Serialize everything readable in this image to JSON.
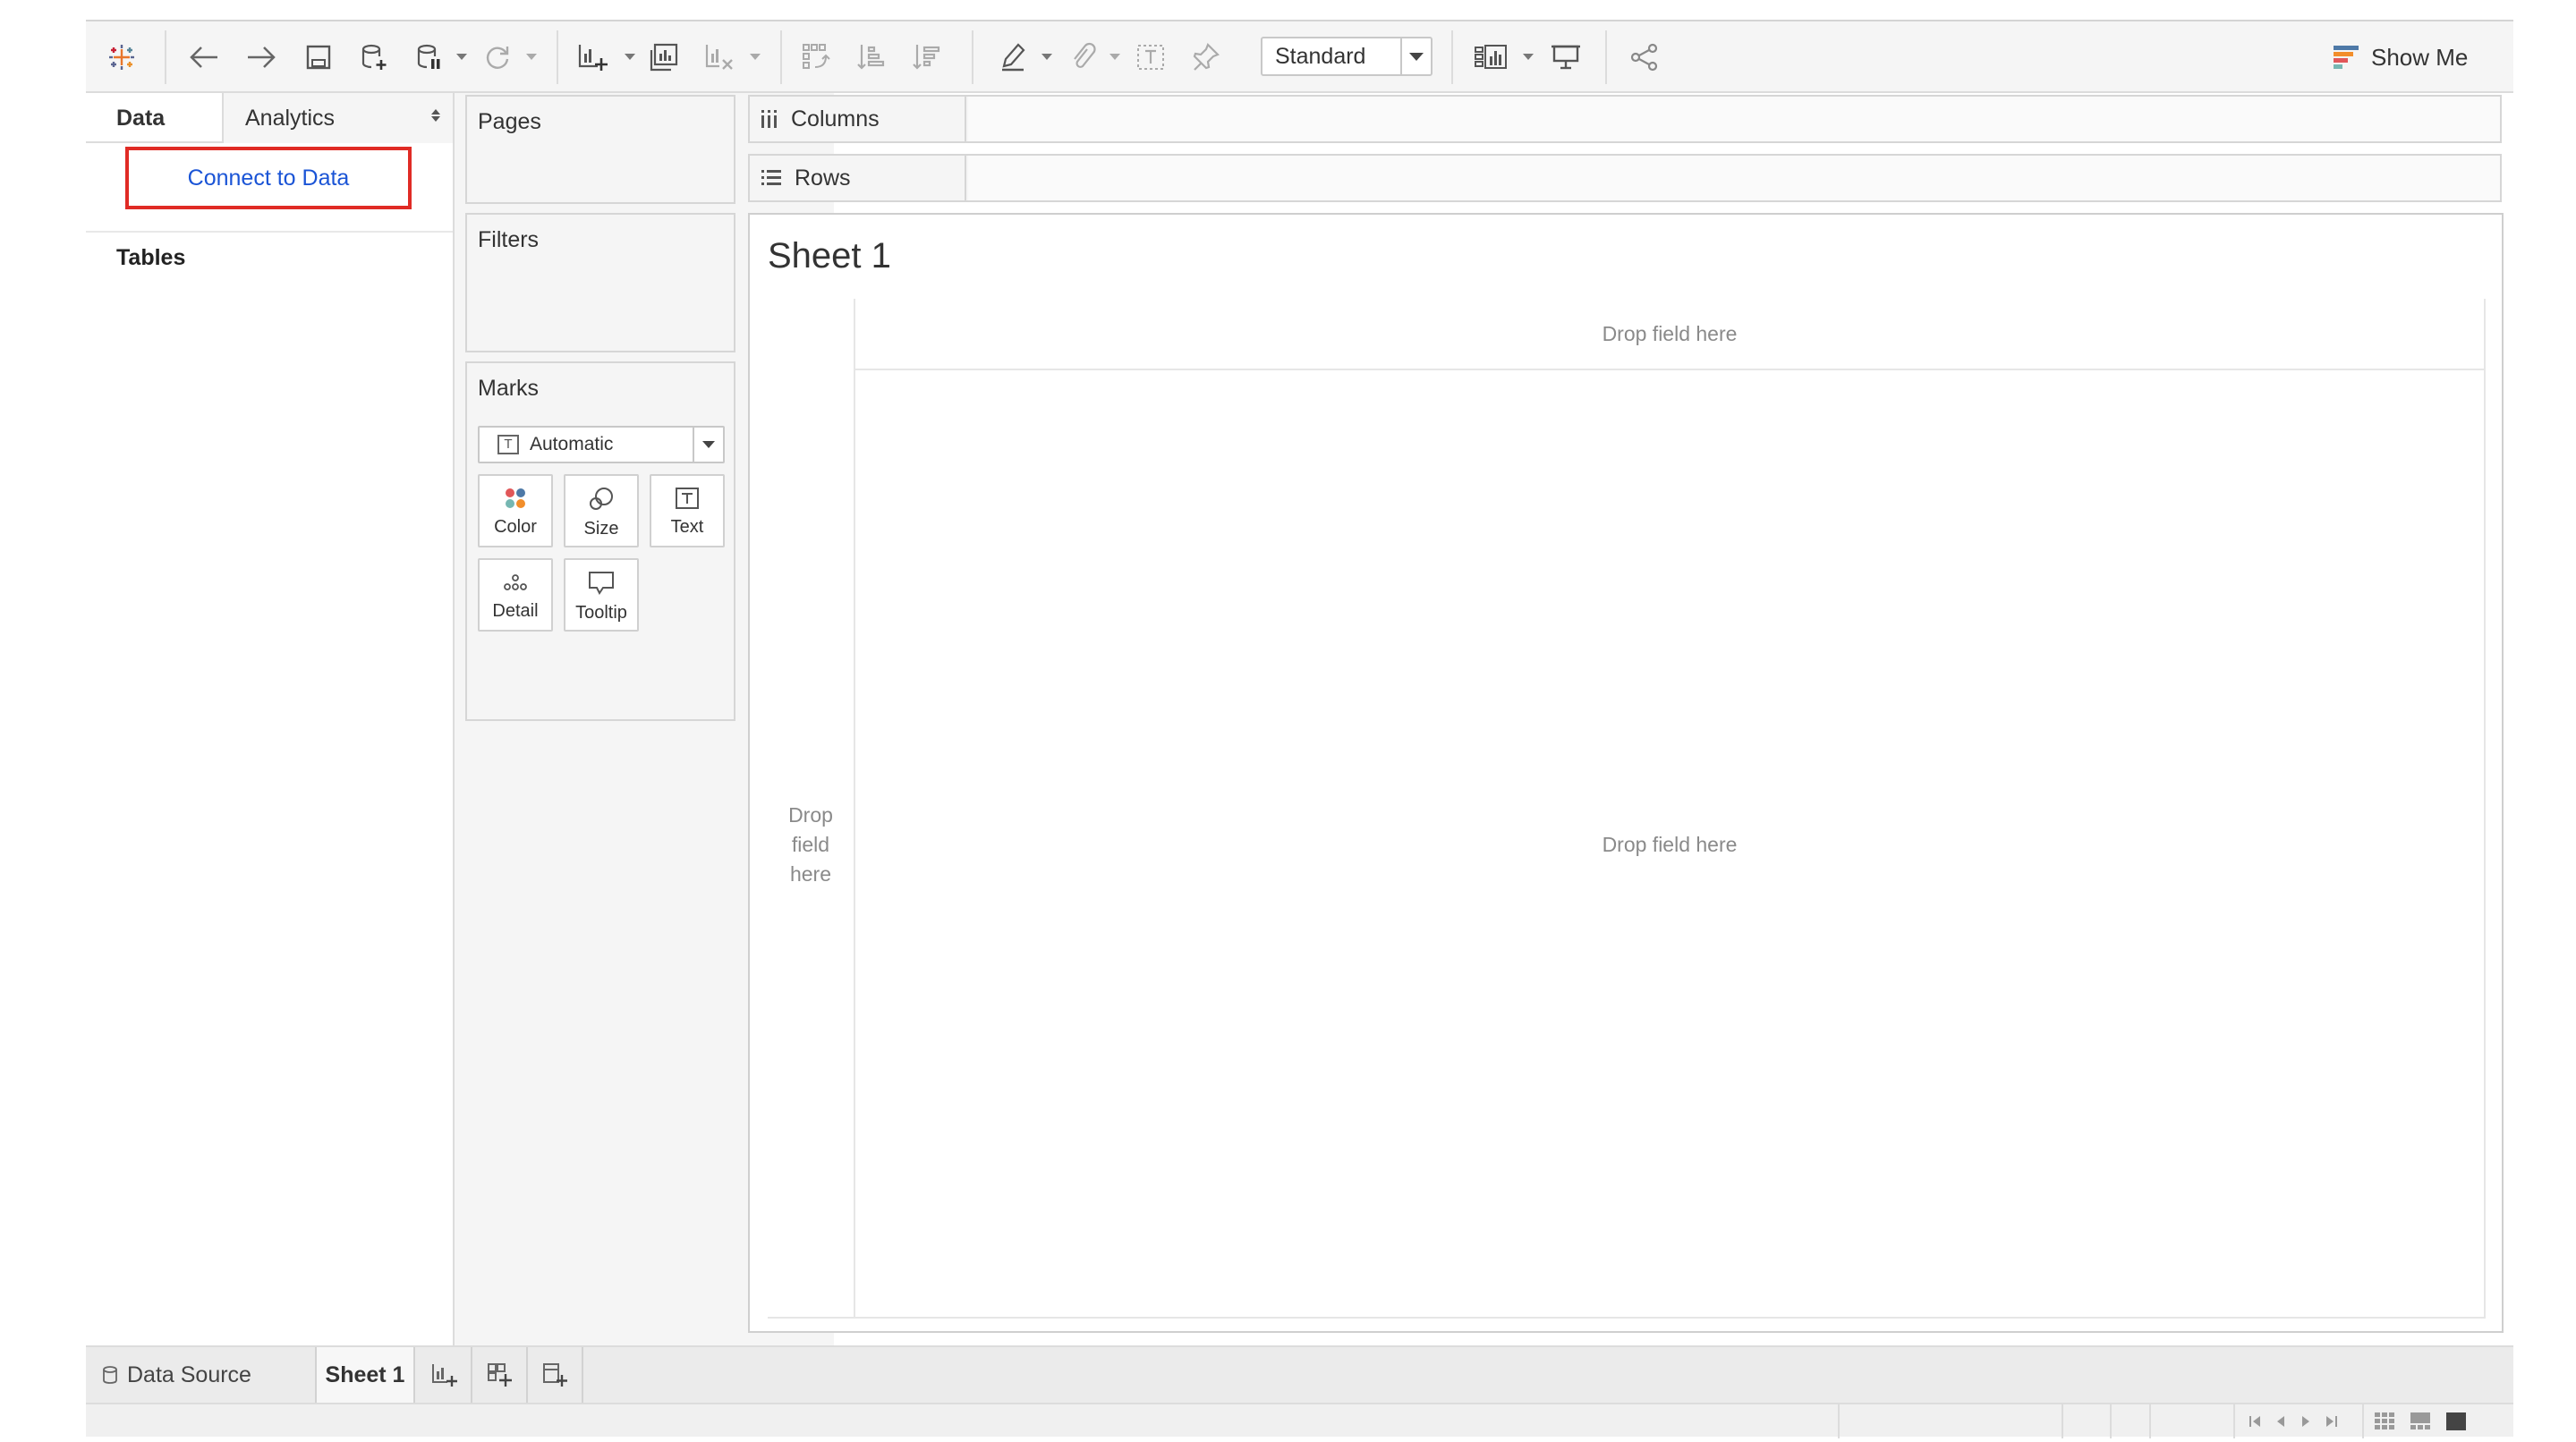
{
  "toolbar": {
    "fit_value": "Standard",
    "show_me_label": "Show Me",
    "show_me_colors": [
      "#4e79a7",
      "#f28e2b",
      "#e15759",
      "#76b7b2"
    ]
  },
  "data_pane": {
    "tabs": {
      "data": "Data",
      "analytics": "Analytics"
    },
    "connect_label": "Connect to Data",
    "tables_heading": "Tables"
  },
  "cards": {
    "pages": "Pages",
    "filters": "Filters",
    "marks": {
      "title": "Marks",
      "mark_type": "Automatic",
      "buttons": {
        "color": "Color",
        "size": "Size",
        "text": "Text",
        "detail": "Detail",
        "tooltip": "Tooltip"
      },
      "color_dots": [
        "#e15759",
        "#4e79a7",
        "#76b7b2",
        "#f28e2b"
      ]
    }
  },
  "shelves": {
    "columns": "Columns",
    "rows": "Rows"
  },
  "view": {
    "sheet_title": "Sheet 1",
    "drop_columns": "Drop field here",
    "drop_rows": "Drop field here",
    "drop_center": "Drop field here"
  },
  "sheet_tabs": {
    "data_source": "Data Source",
    "sheet1": "Sheet 1"
  },
  "theme": {
    "highlight_border": "#e02b25",
    "link_blue": "#1a54d6"
  }
}
